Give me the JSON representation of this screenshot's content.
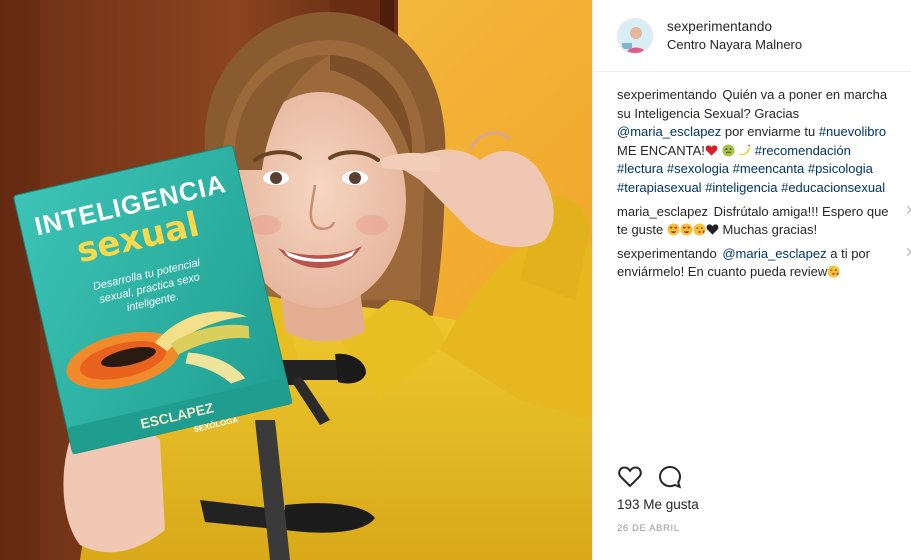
{
  "post": {
    "username": "sexperimentando",
    "location": "Centro Nayara Malnero",
    "book": {
      "title_line1": "INTELIGENCIA",
      "title_line2": "sexual",
      "subtitle_l1": "Desarrolla tu potencial",
      "subtitle_l2": "sexual, practica sexo",
      "subtitle_l3": "inteligente.",
      "author": "ESCLAPEZ",
      "badge": "SEXÓLOGA"
    },
    "caption": {
      "author": "sexperimentando",
      "t1": "Quién va a poner en marcha su Inteligencia Sexual? Gracias",
      "mention": "@maria_esclapez",
      "t2": "por enviarme tu",
      "tag_nuevolibro": "#nuevolibro",
      "t3": "ME ENCANTA!",
      "tag_recomendacion": "#recomendación",
      "tag_lectura": "#lectura",
      "tag_sexologia": "#sexologia",
      "tag_meencanta": "#meencanta",
      "tag_psicologia": "#psicologia",
      "tag_terapiasexual": "#terapiasexual",
      "tag_inteligencia": "#inteligencia",
      "tag_educacionsexual": "#educacionsexual"
    },
    "comments": [
      {
        "author": "maria_esclapez",
        "t1": "Disfrútalo amiga!!! Espero que te guste",
        "t2": "Muchas gracias!"
      },
      {
        "author": "sexperimentando",
        "mention": "@maria_esclapez",
        "t1": "a ti por enviármelo! En cuanto pueda review"
      }
    ],
    "icons": {
      "like": "heart-icon",
      "comment": "comment-icon",
      "close": "close-icon"
    },
    "likes": "193 Me gusta",
    "date": "26 DE ABRIL"
  },
  "colors": {
    "link": "#003569",
    "background_wall": "#f3b533",
    "door": "#7a3a1a",
    "coat": "#e8c024",
    "book_cover": "#2bb6a8"
  }
}
